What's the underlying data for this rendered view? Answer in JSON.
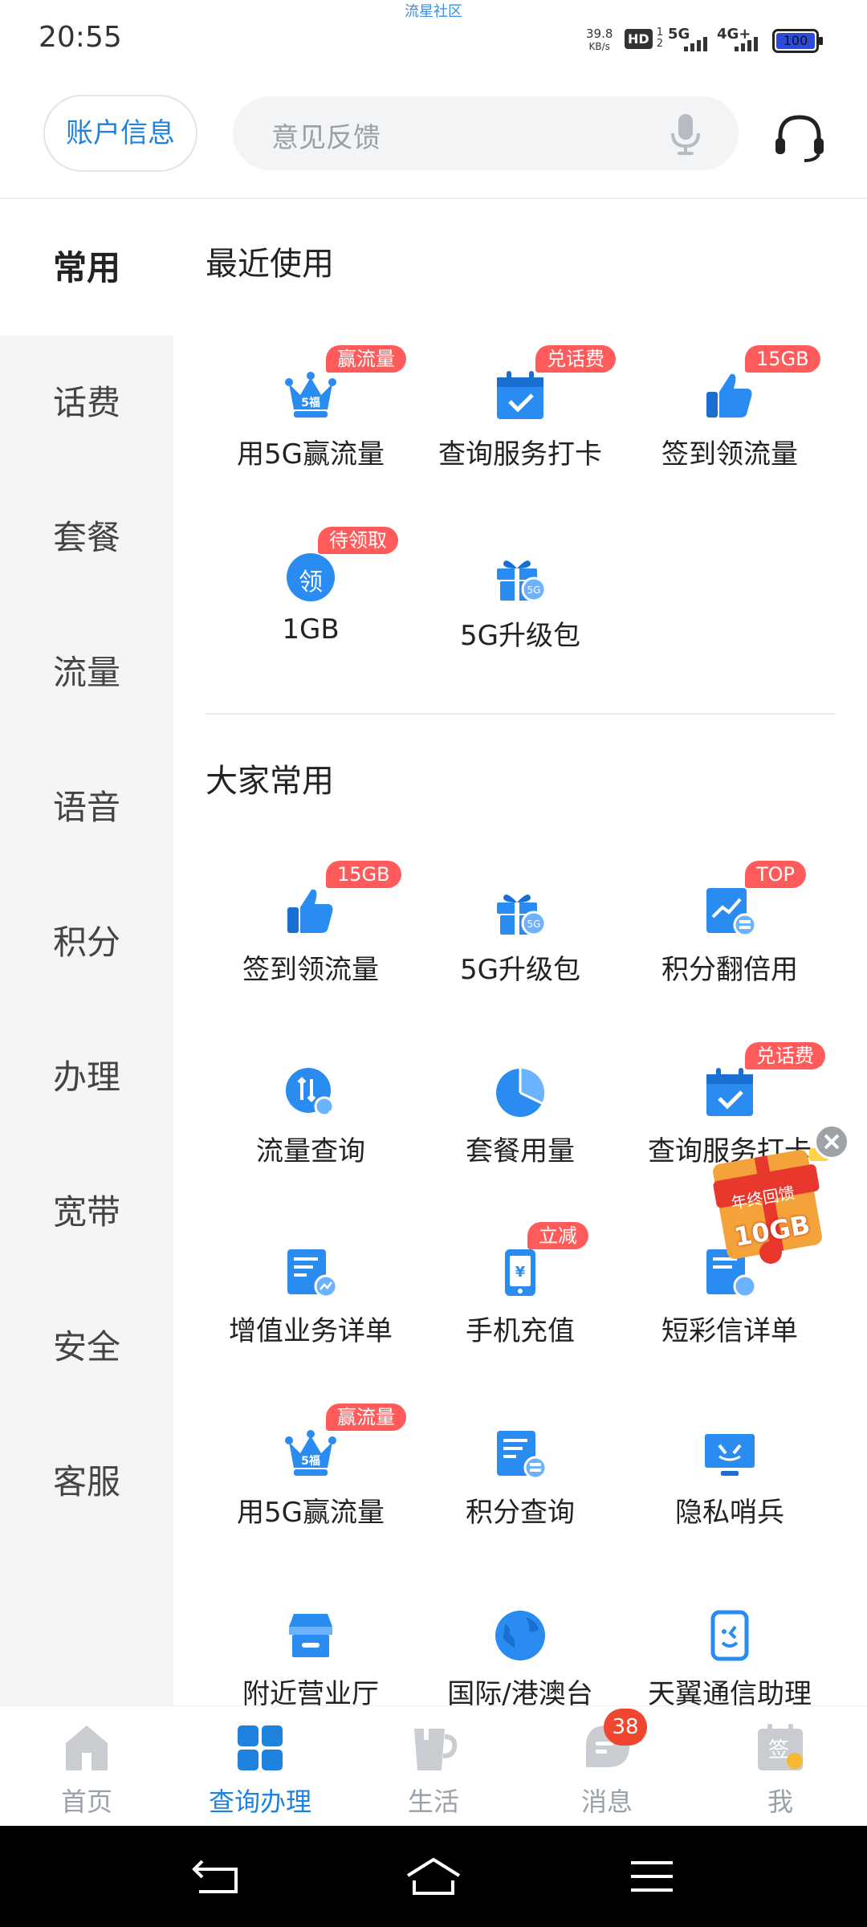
{
  "status_bar": {
    "time": "20:55",
    "top_text": "流星社区",
    "net_speed_value": "39.8",
    "net_speed_unit": "KB/s",
    "hd_text": "HD",
    "sim1": "1",
    "sim2": "2",
    "sim1_network": "5G",
    "sim2_network": "4G+",
    "battery": "100"
  },
  "header": {
    "account_button": "账户信息",
    "search_placeholder": "意见反馈"
  },
  "side_nav": {
    "items": [
      {
        "label": "常用"
      },
      {
        "label": "话费"
      },
      {
        "label": "套餐"
      },
      {
        "label": "流量"
      },
      {
        "label": "语音"
      },
      {
        "label": "积分"
      },
      {
        "label": "办理"
      },
      {
        "label": "宽带"
      },
      {
        "label": "安全"
      },
      {
        "label": "客服"
      }
    ],
    "active_index": 0
  },
  "recent": {
    "title": "最近使用",
    "items": [
      {
        "label": "用5G赢流量",
        "badge": "赢流量",
        "icon": "crown-5g-icon"
      },
      {
        "label": "查询服务打卡",
        "badge": "兑话费",
        "icon": "calendar-check-icon"
      },
      {
        "label": "签到领流量",
        "badge": "15GB",
        "icon": "thumbs-up-icon"
      },
      {
        "label": "1GB",
        "badge": "待领取",
        "icon": "claim-circle-icon",
        "icon_text": "领"
      },
      {
        "label": "5G升级包",
        "badge": "",
        "icon": "gift-5g-icon"
      }
    ]
  },
  "common": {
    "title": "大家常用",
    "items": [
      {
        "label": "签到领流量",
        "badge": "15GB",
        "icon": "thumbs-up-icon"
      },
      {
        "label": "5G升级包",
        "badge": "",
        "icon": "gift-5g-icon"
      },
      {
        "label": "积分翻倍用",
        "badge": "TOP",
        "icon": "points-double-icon"
      },
      {
        "label": "流量查询",
        "badge": "",
        "icon": "data-query-icon"
      },
      {
        "label": "套餐用量",
        "badge": "",
        "icon": "pie-chart-icon"
      },
      {
        "label": "查询服务打卡",
        "badge": "兑话费",
        "icon": "calendar-check-icon"
      },
      {
        "label": "增值业务详单",
        "badge": "",
        "icon": "document-chart-icon"
      },
      {
        "label": "手机充值",
        "badge": "立减",
        "icon": "phone-recharge-icon"
      },
      {
        "label": "短彩信详单",
        "badge": "",
        "icon": "sms-document-icon"
      },
      {
        "label": "用5G赢流量",
        "badge": "赢流量",
        "icon": "crown-5g-icon"
      },
      {
        "label": "积分查询",
        "badge": "",
        "icon": "points-document-icon"
      },
      {
        "label": "隐私哨兵",
        "badge": "",
        "icon": "privacy-monitor-icon"
      },
      {
        "label": "附近营业厅",
        "badge": "",
        "icon": "store-icon"
      },
      {
        "label": "国际/港澳台",
        "badge": "",
        "icon": "globe-icon"
      },
      {
        "label": "天翼通信助理",
        "badge": "",
        "icon": "assistant-phone-icon"
      }
    ]
  },
  "promo": {
    "ribbon": "年终回馈",
    "amount": "10GB"
  },
  "tabbar": {
    "tabs": [
      {
        "label": "首页",
        "icon": "home-icon"
      },
      {
        "label": "查询办理",
        "icon": "grid-icon"
      },
      {
        "label": "生活",
        "icon": "cup-icon"
      },
      {
        "label": "消息",
        "icon": "message-icon",
        "badge": "38"
      },
      {
        "label": "我",
        "icon": "sign-in-calendar-icon",
        "icon_text": "签"
      }
    ],
    "active_index": 1
  },
  "colors": {
    "accent": "#1f82de",
    "icon_blue": "#2a8cf0",
    "badge_red": "#ff5b5b",
    "message_badge": "#f0452f"
  }
}
